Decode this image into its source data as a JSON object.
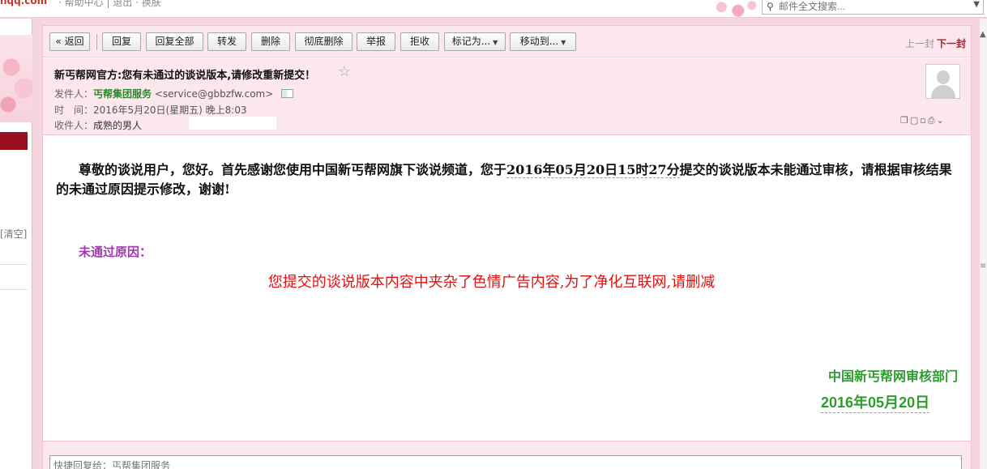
{
  "topbar": {
    "brand": "nqq.com",
    "links": "· 帮助中心 | 退出 · 换肤",
    "search_placeholder": "邮件全文搜索..."
  },
  "sidebar": {
    "clear_label": "[清空]"
  },
  "toolbar": {
    "back": "« 返回",
    "reply": "回复",
    "reply_all": "回复全部",
    "forward": "转发",
    "delete": "删除",
    "delete_forever": "彻底删除",
    "report": "举报",
    "reject": "拒收",
    "mark_as": "标记为...",
    "move_to": "移动到...",
    "prev": "上一封",
    "next": "下一封"
  },
  "header": {
    "subject": "新丐帮网官方:您有未通过的谈说版本,请修改重新提交！",
    "sender_label": "发件人：",
    "sender_name": "丐帮集团服务",
    "sender_email": "<service@gbbzfw.com>",
    "time_label": "时　间：",
    "time_value": "2016年5月20日(星期五) 晚上8:03",
    "recipient_label": "收件人：",
    "recipient_value": "成熟的男人"
  },
  "body": {
    "para_prefix": "尊敬的谈说用户，您好。首先感谢您使用中国新丐帮网旗下谈说频道，您于",
    "para_datetime": "2016年05月20日15时27分",
    "para_suffix": "提交的谈说版本未能通过审核，请根据审核结果的未通过原因提示修改，谢谢!",
    "reason_label": "未通过原因：",
    "reason_text": "您提交的谈说版本内容中夹杂了色情广告内容,为了净化互联网,请删减",
    "department": "中国新丐帮网审核部门",
    "sign_date": "2016年05月20日"
  },
  "reply": {
    "placeholder": "快捷回复给：丐帮集团服务"
  },
  "colors": {
    "accent_pink": "#fce7ec",
    "reason_red": "#e01010",
    "signature_green": "#2e9d2e",
    "label_purple": "#9b3aa8"
  }
}
